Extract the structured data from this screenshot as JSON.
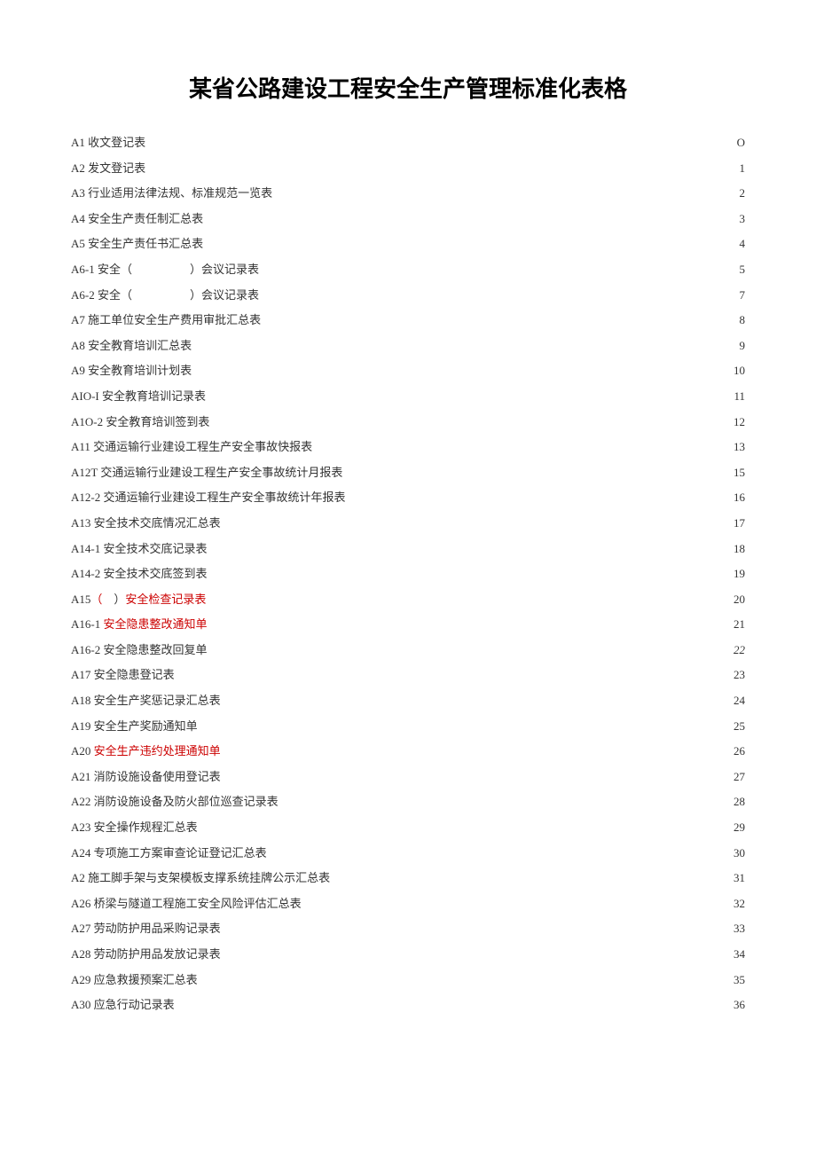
{
  "title": "某省公路建设工程安全生产管理标准化表格",
  "items": [
    {
      "label": "A1 收文登记表",
      "page": "O",
      "highlight": false
    },
    {
      "label": "A2 发文登记表",
      "page": "1",
      "highlight": false
    },
    {
      "label": "A3 行业适用法律法规、标准规范一览表",
      "page": "2",
      "highlight": false
    },
    {
      "label": "A4 安全生产责任制汇总表",
      "page": "3",
      "highlight": false
    },
    {
      "label": "A5 安全生产责任书汇总表",
      "page": "4",
      "highlight": false
    },
    {
      "label": "A6-1 安全（　　　　　）会议记录表",
      "page": "5",
      "highlight": false
    },
    {
      "label": "A6-2 安全（　　　　　）会议记录表",
      "page": "7",
      "highlight": false
    },
    {
      "label": "A7 施工单位安全生产费用审批汇总表",
      "page": "8",
      "highlight": false
    },
    {
      "label": "A8 安全教育培训汇总表",
      "page": "9",
      "highlight": false
    },
    {
      "label": "A9 安全教育培训计划表",
      "page": "10",
      "highlight": false
    },
    {
      "label": "AIO-I 安全教育培训记录表",
      "page": "11",
      "highlight": false
    },
    {
      "label": "A1O-2 安全教育培训签到表",
      "page": "12",
      "highlight": false
    },
    {
      "label": "A11 交通运输行业建设工程生产安全事故快报表",
      "page": "13",
      "highlight": false
    },
    {
      "label": "A12T 交通运输行业建设工程生产安全事故统计月报表",
      "page": "15",
      "highlight": false
    },
    {
      "label": "A12-2 交通运输行业建设工程生产安全事故统计年报表",
      "page": "16",
      "highlight": false
    },
    {
      "label": "A13 安全技术交底情况汇总表",
      "page": "17",
      "highlight": false
    },
    {
      "label": "A14-1 安全技术交底记录表",
      "page": "18",
      "highlight": false
    },
    {
      "label": "A14-2 安全技术交底签到表",
      "page": "19",
      "highlight": false
    },
    {
      "label_prefix": "A15（　）",
      "label_highlight": "安全检查记录表",
      "page": "20",
      "highlight": true
    },
    {
      "label_prefix": "A16-1 ",
      "label_highlight": "安全隐患整改通知单",
      "page": "21",
      "highlight": true
    },
    {
      "label": "A16-2 安全隐患整改回复单",
      "page": "22",
      "highlight": false,
      "italic": true
    },
    {
      "label": "A17 安全隐患登记表",
      "page": "23",
      "highlight": false
    },
    {
      "label": "A18 安全生产奖惩记录汇总表",
      "page": "24",
      "highlight": false
    },
    {
      "label": "A19 安全生产奖励通知单",
      "page": "25",
      "highlight": false
    },
    {
      "label_prefix": "A20 ",
      "label_highlight": "安全生产违约处理通知单",
      "page": "26",
      "highlight": true
    },
    {
      "label": "A21 消防设施设备使用登记表",
      "page": "27",
      "highlight": false
    },
    {
      "label": "A22 消防设施设备及防火部位巡查记录表",
      "page": "28",
      "highlight": false
    },
    {
      "label": "A23 安全操作规程汇总表",
      "page": "29",
      "highlight": false
    },
    {
      "label": "A24 专项施工方案审查论证登记汇总表",
      "page": "30",
      "highlight": false
    },
    {
      "label": "A2 施工脚手架与支架模板支撑系统挂牌公示汇总表",
      "page": "31",
      "highlight": false
    },
    {
      "label": "A26 桥梁与隧道工程施工安全风险评估汇总表",
      "page": "32",
      "highlight": false
    },
    {
      "label": "A27 劳动防护用品采购记录表",
      "page": "33",
      "highlight": false
    },
    {
      "label": "A28 劳动防护用品发放记录表",
      "page": "34",
      "highlight": false
    },
    {
      "label": "A29 应急救援预案汇总表",
      "page": "35",
      "highlight": false
    },
    {
      "label": "A30 应急行动记录表",
      "page": "36",
      "highlight": false
    }
  ]
}
